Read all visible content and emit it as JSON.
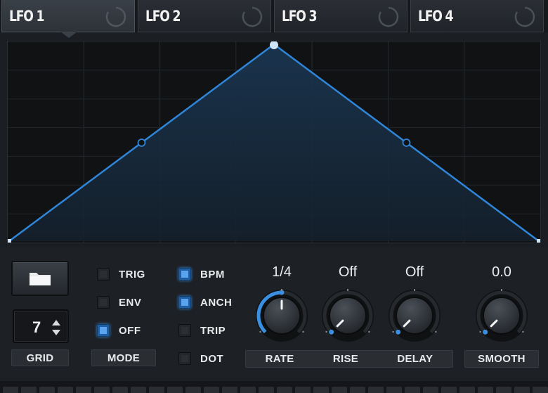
{
  "tabs": [
    {
      "label": "LFO 1",
      "active": true
    },
    {
      "label": "LFO 2",
      "active": false
    },
    {
      "label": "LFO 3",
      "active": false
    },
    {
      "label": "LFO 4",
      "active": false
    }
  ],
  "lfo_shape": {
    "points": [
      {
        "t": 0.0,
        "v": 0.0,
        "node": "endpoint"
      },
      {
        "t": 0.25,
        "v": 0.5,
        "node": "curve-handle"
      },
      {
        "t": 0.5,
        "v": 1.0,
        "node": "peak"
      },
      {
        "t": 0.75,
        "v": 0.5,
        "node": "curve-handle"
      },
      {
        "t": 1.0,
        "v": 0.0,
        "node": "endpoint"
      }
    ],
    "line_color": "#2f86d8",
    "fill_color": "#1a3550"
  },
  "grid": {
    "value": "7",
    "label": "GRID",
    "divisions": 7
  },
  "mode": {
    "label": "MODE",
    "options": [
      {
        "label": "TRIG",
        "on": false
      },
      {
        "label": "ENV",
        "on": false
      },
      {
        "label": "OFF",
        "on": true
      }
    ]
  },
  "timing": {
    "options": [
      {
        "label": "BPM",
        "on": true
      },
      {
        "label": "ANCH",
        "on": true
      },
      {
        "label": "TRIP",
        "on": false
      },
      {
        "label": "DOT",
        "on": false
      }
    ]
  },
  "knobs": [
    {
      "label": "RATE",
      "value": "1/4",
      "position": 0.5
    },
    {
      "label": "RISE",
      "value": "Off",
      "position": 0.0
    },
    {
      "label": "DELAY",
      "value": "Off",
      "position": 0.0
    },
    {
      "label": "SMOOTH",
      "value": "0.0",
      "position": 0.0
    }
  ],
  "icons": {
    "folder": "folder-icon",
    "stepper": "up-down-arrows-icon",
    "tab_status": "ring-icon"
  },
  "colors": {
    "accent": "#3a8fe0",
    "background": "#1b1e22",
    "graph_bg": "#101214"
  }
}
